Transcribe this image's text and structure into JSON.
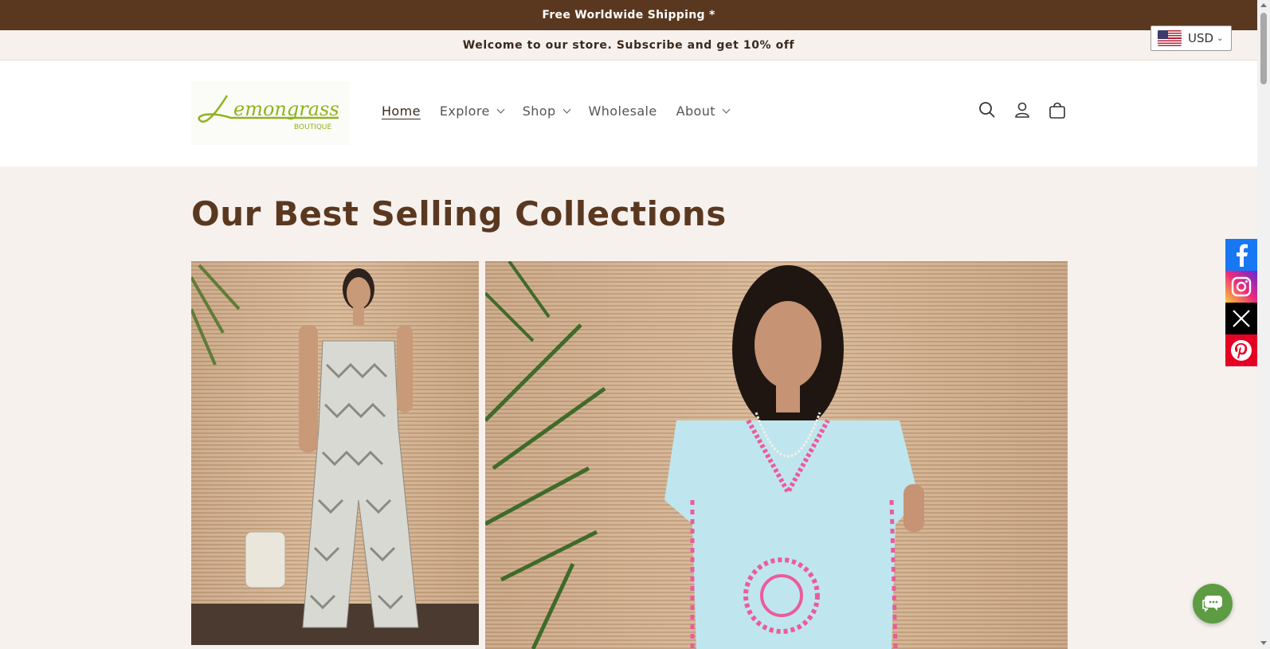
{
  "announcement": {
    "text": "Free Worldwide Shipping *"
  },
  "welcome": {
    "text": "Welcome to our store. Subscribe and get 10% off"
  },
  "currency": {
    "code": "USD",
    "flag": "us-flag-icon"
  },
  "logo": {
    "text": "Lemongrass",
    "subtext": "BOUTIQUE"
  },
  "nav": {
    "items": [
      {
        "label": "Home",
        "active": true,
        "dropdown": false
      },
      {
        "label": "Explore",
        "dropdown": true
      },
      {
        "label": "Shop",
        "dropdown": true
      },
      {
        "label": "Wholesale",
        "dropdown": false
      },
      {
        "label": "About",
        "dropdown": true
      }
    ]
  },
  "header_icons": [
    "search-icon",
    "account-icon",
    "cart-icon"
  ],
  "collection": {
    "title": "Our Best Selling Collections"
  },
  "social": [
    {
      "name": "facebook",
      "color": "#1877f2"
    },
    {
      "name": "instagram",
      "color": "#d62976"
    },
    {
      "name": "x",
      "color": "#000000"
    },
    {
      "name": "pinterest",
      "color": "#e60023"
    }
  ],
  "colors": {
    "brand_brown": "#5a3820",
    "background": "#f7f1ee",
    "chat_green": "#5d9c42"
  }
}
